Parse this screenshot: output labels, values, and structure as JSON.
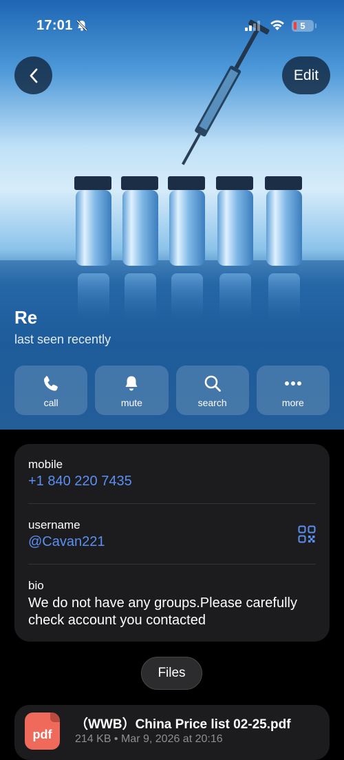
{
  "status_bar": {
    "time": "17:01",
    "battery": "5"
  },
  "header": {
    "edit_label": "Edit"
  },
  "profile": {
    "name": "Re",
    "status": "last seen recently"
  },
  "actions": [
    {
      "label": "call",
      "icon": "phone-icon"
    },
    {
      "label": "mute",
      "icon": "bell-icon"
    },
    {
      "label": "search",
      "icon": "search-icon"
    },
    {
      "label": "more",
      "icon": "more-icon"
    }
  ],
  "info": {
    "mobile_label": "mobile",
    "mobile_value": "+1 840 220 7435",
    "username_label": "username",
    "username_value": "@Cavan221",
    "bio_label": "bio",
    "bio_value": "We do not have any groups.Please carefully check account you contacted"
  },
  "files_tab": {
    "label": "Files"
  },
  "files": [
    {
      "icon_text": "pdf",
      "name": "（WWB）China Price list 02-25.pdf",
      "meta": "214 KB • Mar 9, 2026 at 20:16"
    }
  ],
  "colors": {
    "link": "#5b8ff2",
    "card_bg": "#1c1c1e",
    "pdf_icon": "#f06a5c"
  }
}
